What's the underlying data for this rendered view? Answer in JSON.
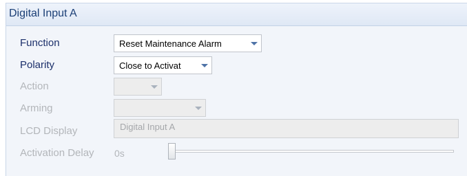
{
  "panel": {
    "title": "Digital Input A"
  },
  "fields": {
    "function": {
      "label": "Function",
      "value": "Reset Maintenance Alarm",
      "enabled": true
    },
    "polarity": {
      "label": "Polarity",
      "value": "Close to Activat",
      "enabled": true
    },
    "action": {
      "label": "Action",
      "value": "",
      "enabled": false
    },
    "arming": {
      "label": "Arming",
      "value": "",
      "enabled": false
    },
    "lcd_display": {
      "label": "LCD Display",
      "value": "Digital Input A",
      "enabled": false
    },
    "activation_delay": {
      "label": "Activation Delay",
      "value_text": "0s",
      "slider_fraction": 0.0,
      "enabled": false
    }
  },
  "icons": {
    "dropdown": "chevron-down-icon"
  },
  "colors": {
    "enabled_label": "#1b2f6a",
    "disabled_label": "#b3b6ba",
    "header_text": "#1b3f76",
    "dropdown_arrow": "#4e73a7"
  }
}
